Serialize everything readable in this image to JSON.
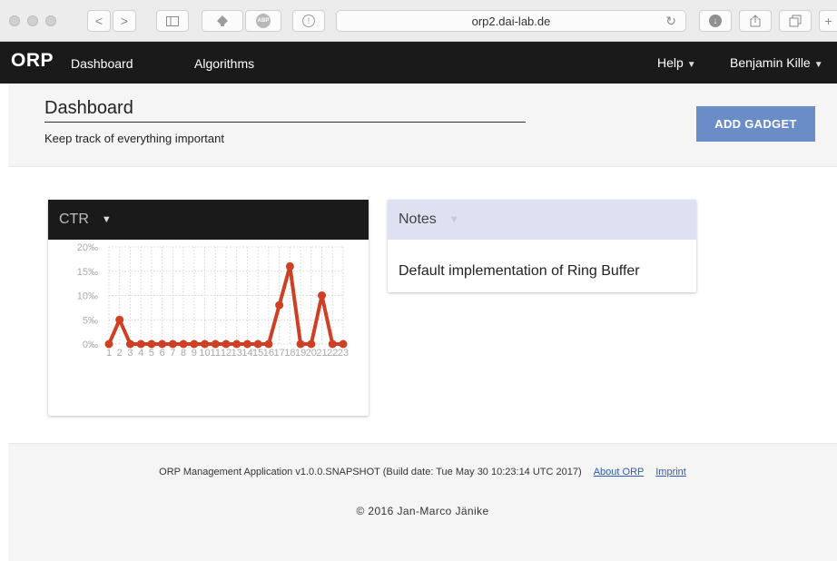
{
  "browser": {
    "url": "orp2.dai-lab.de",
    "back_icon": "<",
    "forward_icon": ">",
    "abp_label": "ABP"
  },
  "navbar": {
    "brand": "ORP",
    "links": [
      "Dashboard",
      "Algorithms"
    ],
    "help": "Help",
    "user": "Benjamin Kille"
  },
  "header": {
    "title": "Dashboard",
    "subtitle": "Keep track of everything important",
    "add_gadget": "ADD GADGET"
  },
  "gadgets": {
    "ctr_title": "CTR",
    "notes_title": "Notes",
    "notes_text": "Default implementation of Ring Buffer"
  },
  "chart_data": {
    "type": "line",
    "x": [
      1,
      2,
      3,
      4,
      5,
      6,
      7,
      8,
      9,
      10,
      11,
      12,
      13,
      14,
      15,
      16,
      17,
      18,
      19,
      20,
      21,
      22,
      23
    ],
    "values": [
      0,
      5,
      0,
      0,
      0,
      0,
      0,
      0,
      0,
      0,
      0,
      0,
      0,
      0,
      0,
      0,
      8,
      16,
      0,
      0,
      10,
      0,
      0
    ],
    "y_ticks": [
      "0‰",
      "5‰",
      "10‰",
      "15‰",
      "20‰"
    ],
    "ylim": [
      0,
      20
    ],
    "grid": true,
    "color": "#cf3f23"
  },
  "footer": {
    "app_info": "ORP Management Application v1.0.0.SNAPSHOT (Build date: Tue May 30 10:23:14 UTC 2017)",
    "about": "About ORP",
    "imprint": "Imprint",
    "copyright": "© 2016 Jan-Marco Jänike"
  },
  "colors": {
    "navbar": "#1a1a1a",
    "button": "#6a8dc7",
    "notes_header": "#dde1f1",
    "line": "#cf3f23"
  }
}
